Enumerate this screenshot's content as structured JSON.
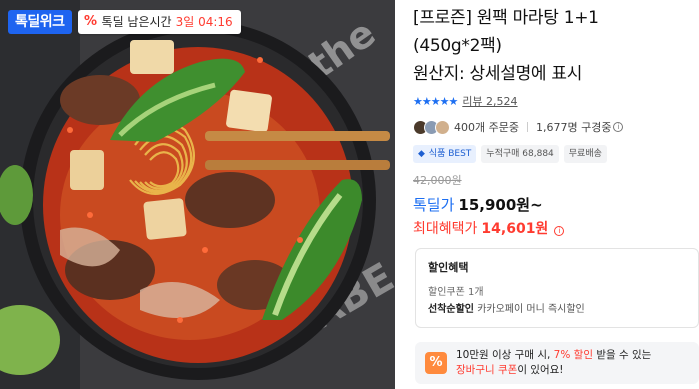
{
  "promo": {
    "logo": "톡딜위크",
    "timer_label": "톡딜 남은시간",
    "timer_value": "3일 04:16"
  },
  "product": {
    "title_line1": "[프로즌] 원팩 마라탕 1+1",
    "title_line2": "(450g*2팩)",
    "title_line3": "원산지: 상세설명에 표시",
    "stars": "★★★★★",
    "review_label": "리뷰 2,524",
    "order_count": "400개 주문중",
    "watch_count": "1,677명 구경중",
    "badges": {
      "best": "식품 BEST",
      "cumulative": "누적구매 68,884",
      "shipping": "무료배송"
    },
    "original_price": "42,000원",
    "deal_label": "톡딜가",
    "deal_price": "15,900원~",
    "max_label": "최대혜택가",
    "max_price": "14,601원"
  },
  "discount": {
    "title": "할인혜택",
    "coupon_line": "할인쿠폰 1개",
    "first_come_label": "선착순할인",
    "first_come_text": "카카오페이 머니 즉시할인"
  },
  "coupon_banner": {
    "text_a": "10만원 이상 구매 시, ",
    "text_highlight": "7% 할인",
    "text_b": " 받을 수 있는",
    "text_c_highlight": "장바구니 쿠폰",
    "text_d": "이 있어요!"
  },
  "colors": {
    "accent_blue": "#1d6ff2",
    "sale_red": "#ff3b30",
    "coupon_orange": "#ff8a3d"
  },
  "icons": [
    "percent-icon",
    "star-icon",
    "info-icon",
    "shield-icon",
    "coupon-icon"
  ]
}
